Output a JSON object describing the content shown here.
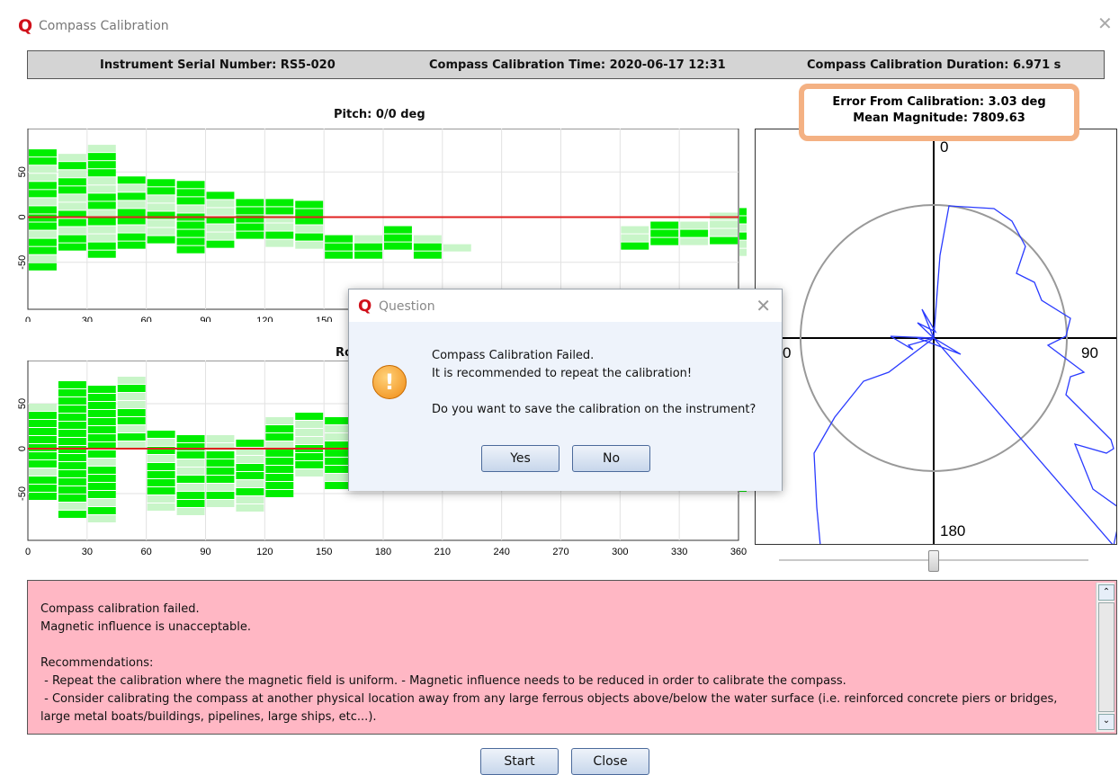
{
  "window": {
    "app_icon": "Q",
    "title": "Compass Calibration",
    "close_glyph": "✕"
  },
  "info": {
    "serial": "Instrument Serial Number: RS5-020",
    "time": "Compass Calibration Time: 2020-06-17 12:31",
    "duration": "Compass Calibration Duration: 6.971 s"
  },
  "error_box": {
    "error": "Error From Calibration: 3.03 deg",
    "magnitude": "Mean Magnitude: 7809.63"
  },
  "pitch_plot": {
    "title": "Pitch: 0/0 deg"
  },
  "roll_plot": {
    "title_visible": "Ro"
  },
  "x_ticks": [
    "0",
    "30",
    "60",
    "90",
    "120",
    "150",
    "180",
    "210",
    "240",
    "270",
    "300",
    "330",
    "360"
  ],
  "y_ticks": [
    "50",
    "0",
    "-50"
  ],
  "polar": {
    "label_top": "0",
    "label_left": "0",
    "label_right": "90",
    "label_bottom": "180"
  },
  "log": {
    "lines": [
      "Compass calibration failed.",
      "Magnetic influence is unacceptable.",
      "",
      "Recommendations:",
      " - Repeat the calibration where the magnetic field is uniform. - Magnetic influence needs to be reduced in order to calibrate the compass.",
      " - Consider calibrating the compass at another physical location away from any large ferrous objects above/below the water surface (i.e. reinforced concrete piers or bridges,",
      "large metal boats/buildings, pipelines, large ships, etc...)."
    ]
  },
  "buttons": {
    "start": "Start",
    "close": "Close"
  },
  "dialog": {
    "icon": "Q",
    "title": "Question",
    "close_glyph": "✕",
    "line1": "Compass Calibration Failed.",
    "line2": "It is recommended to repeat the calibration!",
    "line3": "Do you want to save the calibration on the instrument?",
    "yes": "Yes",
    "no": "No",
    "warn_icon": "warning-icon"
  },
  "colors": {
    "accent_red": "#d0101a",
    "green": "#00ee00",
    "light_green": "#c8f5c8",
    "log_bg": "#ffb7c4",
    "highlight": "#f4b183"
  }
}
